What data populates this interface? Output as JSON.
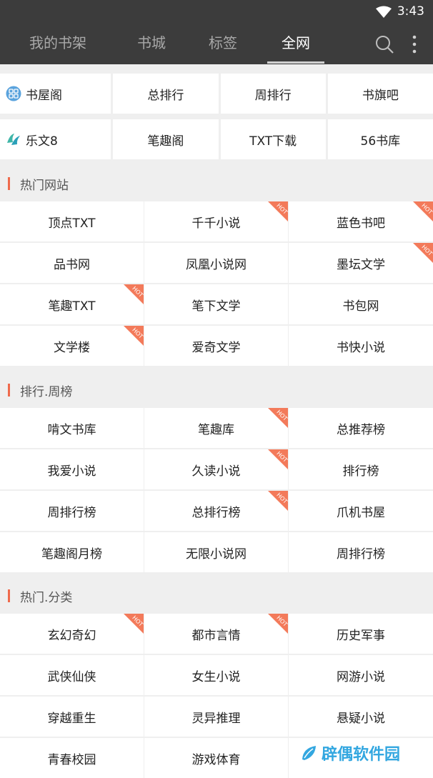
{
  "status": {
    "time": "3:43"
  },
  "nav": {
    "tabs": [
      {
        "label": "我的书架",
        "active": false
      },
      {
        "label": "书城",
        "active": false
      },
      {
        "label": "标签",
        "active": false
      },
      {
        "label": "全网",
        "active": true
      }
    ]
  },
  "quick_rows": [
    [
      {
        "label": "书屋阁",
        "logo": "shuwuge-logo"
      },
      {
        "label": "总排行"
      },
      {
        "label": "周排行"
      },
      {
        "label": "书旗吧"
      }
    ],
    [
      {
        "label": "乐文8",
        "logo": "lewen-logo"
      },
      {
        "label": "笔趣阁"
      },
      {
        "label": "TXT下载"
      },
      {
        "label": "56书库"
      }
    ]
  ],
  "sections": [
    {
      "title": "热门网站",
      "items": [
        {
          "label": "顶点TXT",
          "hot": false
        },
        {
          "label": "千千小说",
          "hot": true
        },
        {
          "label": "蓝色书吧",
          "hot": true
        },
        {
          "label": "品书网",
          "hot": false
        },
        {
          "label": "凤凰小说网",
          "hot": false
        },
        {
          "label": "墨坛文学",
          "hot": true
        },
        {
          "label": "笔趣TXT",
          "hot": true
        },
        {
          "label": "笔下文学",
          "hot": false
        },
        {
          "label": "书包网",
          "hot": false
        },
        {
          "label": "文学楼",
          "hot": true
        },
        {
          "label": "爱奇文学",
          "hot": false
        },
        {
          "label": "书快小说",
          "hot": false
        }
      ]
    },
    {
      "title": "排行.周榜",
      "items": [
        {
          "label": "啃文书库",
          "hot": false
        },
        {
          "label": "笔趣库",
          "hot": true
        },
        {
          "label": "总推荐榜",
          "hot": false
        },
        {
          "label": "我爱小说",
          "hot": false
        },
        {
          "label": "久读小说",
          "hot": true
        },
        {
          "label": "排行榜",
          "hot": false
        },
        {
          "label": "周排行榜",
          "hot": false
        },
        {
          "label": "总排行榜",
          "hot": true
        },
        {
          "label": "爪机书屋",
          "hot": false
        },
        {
          "label": "笔趣阁月榜",
          "hot": false
        },
        {
          "label": "无限小说网",
          "hot": false
        },
        {
          "label": "周排行榜",
          "hot": false
        }
      ]
    },
    {
      "title": "热门.分类",
      "items": [
        {
          "label": "玄幻奇幻",
          "hot": true
        },
        {
          "label": "都市言情",
          "hot": true
        },
        {
          "label": "历史军事",
          "hot": false
        },
        {
          "label": "武侠仙侠",
          "hot": false
        },
        {
          "label": "女生小说",
          "hot": false
        },
        {
          "label": "网游小说",
          "hot": false
        },
        {
          "label": "穿越重生",
          "hot": false
        },
        {
          "label": "灵异推理",
          "hot": false
        },
        {
          "label": "悬疑小说",
          "hot": false
        },
        {
          "label": "青春校园",
          "hot": false
        },
        {
          "label": "游戏体育",
          "hot": false
        },
        {
          "label": "",
          "hot": false
        }
      ]
    }
  ],
  "hot_badge": "HOT",
  "watermark": "辟偶软件园",
  "colors": {
    "toolbar": "#3c3c3c",
    "accent": "#ef6a4c",
    "hot_badge": "#f37a5a",
    "watermark": "#33a7e0"
  }
}
